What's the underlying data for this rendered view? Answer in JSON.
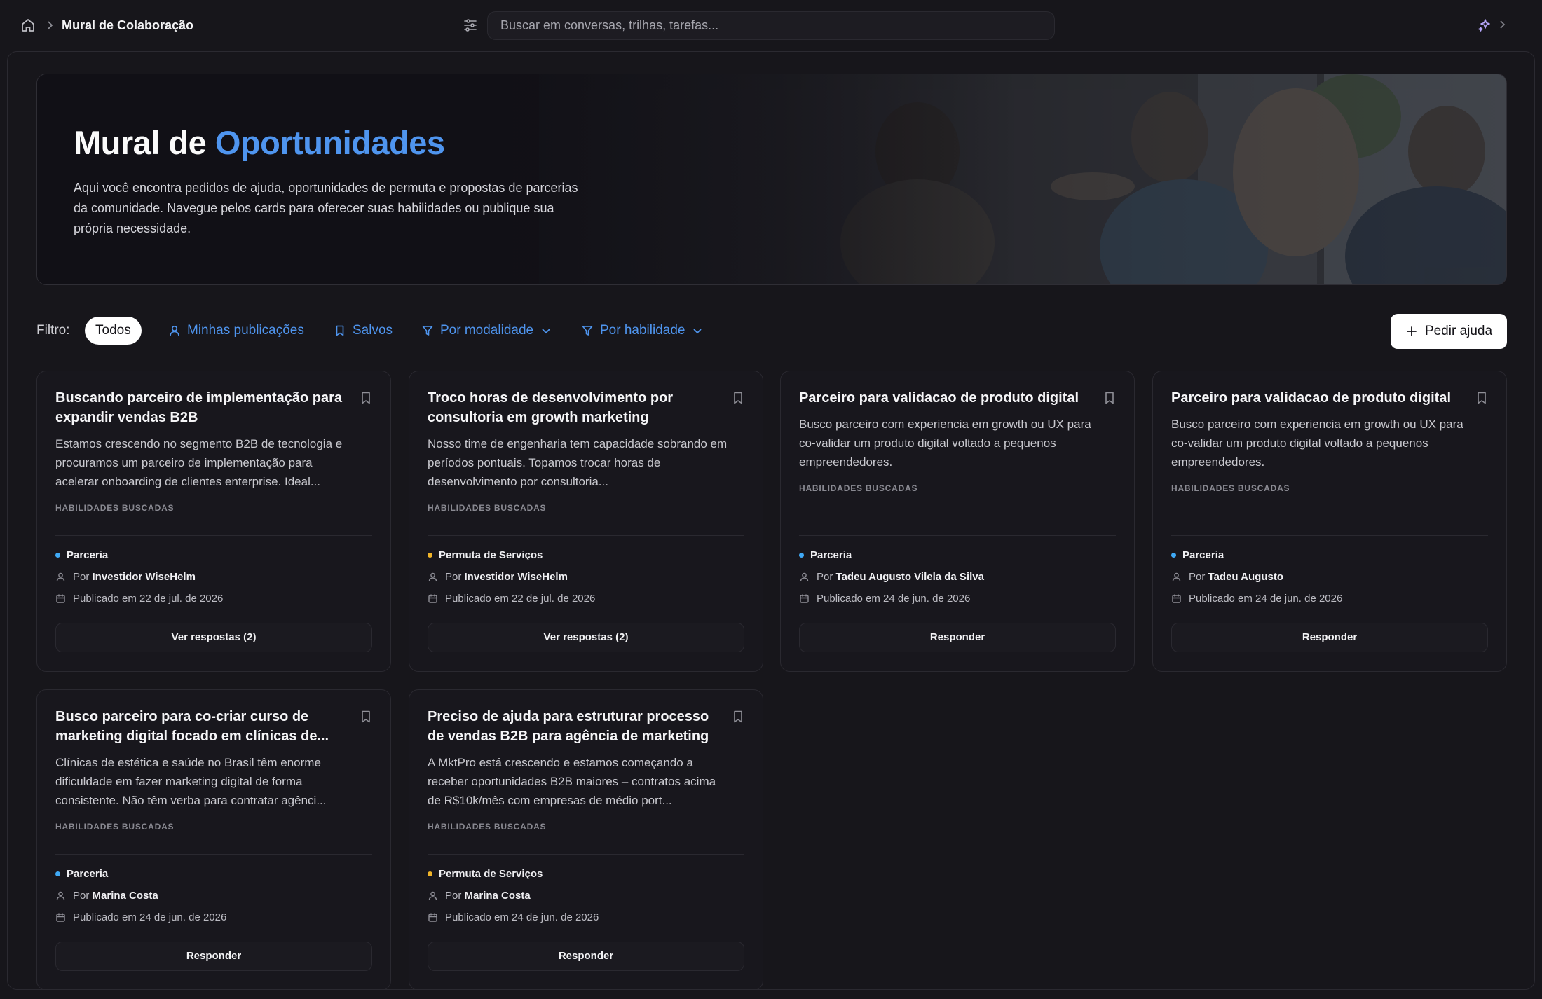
{
  "topbar": {
    "breadcrumb_title": "Mural de Colaboração",
    "search_placeholder": "Buscar em conversas, trilhas, tarefas...",
    "icons": [
      "home-icon",
      "chevron-right-icon",
      "filter-sliders-icon",
      "sparkle-icon",
      "chevron-right-icon"
    ]
  },
  "hero": {
    "title_prefix": "Mural de",
    "title_accent": "Oportunidades",
    "description": "Aqui você encontra pedidos de ajuda, oportunidades de permuta e propostas de parcerias da comunidade. Navegue pelos cards para oferecer suas habilidades ou publique sua própria necessidade.",
    "accent_color": "#4f95ef"
  },
  "filters": {
    "label": "Filtro:",
    "all": "Todos",
    "mine": "Minhas publicações",
    "saved": "Salvos",
    "by_mode": "Por modalidade",
    "by_skill": "Por habilidade",
    "new_request": "Pedir ajuda"
  },
  "cards": [
    {
      "title": "Buscando parceiro de implementação para expandir vendas B2B",
      "description": "Estamos crescendo no segmento B2B de tecnologia e procuramos um parceiro de implementação para acelerar onboarding de clientes enterprise. Ideal...",
      "skills_label": "HABILIDADES BUSCADAS",
      "type": "Parceria",
      "type_color": "#3fa9f5",
      "author_prefix": "Por",
      "author": "Investidor WiseHelm",
      "published": "Publicado em 22 de jul. de 2026",
      "action": "Ver respostas (2)"
    },
    {
      "title": "Troco horas de desenvolvimento por consultoria em growth marketing",
      "description": "Nosso time de engenharia tem capacidade sobrando em períodos pontuais. Topamos trocar horas de desenvolvimento por consultoria...",
      "skills_label": "HABILIDADES BUSCADAS",
      "type": "Permuta de Serviços",
      "type_color": "#f0b429",
      "author_prefix": "Por",
      "author": "Investidor WiseHelm",
      "published": "Publicado em 22 de jul. de 2026",
      "action": "Ver respostas (2)"
    },
    {
      "title": "Parceiro para validacao de produto digital",
      "description": "Busco parceiro com experiencia em growth ou UX para co-validar um produto digital voltado a pequenos empreendedores.",
      "skills_label": "HABILIDADES BUSCADAS",
      "type": "Parceria",
      "type_color": "#3fa9f5",
      "author_prefix": "Por",
      "author": "Tadeu Augusto Vilela da Silva",
      "published": "Publicado em 24 de jun. de 2026",
      "action": "Responder"
    },
    {
      "title": "Parceiro para validacao de produto digital",
      "description": "Busco parceiro com experiencia em growth ou UX para co-validar um produto digital voltado a pequenos empreendedores.",
      "skills_label": "HABILIDADES BUSCADAS",
      "type": "Parceria",
      "type_color": "#3fa9f5",
      "author_prefix": "Por",
      "author": "Tadeu Augusto",
      "published": "Publicado em 24 de jun. de 2026",
      "action": "Responder"
    },
    {
      "title": "Busco parceiro para co-criar curso de marketing digital focado em clínicas de...",
      "description": "Clínicas de estética e saúde no Brasil têm enorme dificuldade em fazer marketing digital de forma consistente. Não têm verba para contratar agênci...",
      "skills_label": "HABILIDADES BUSCADAS",
      "type": "Parceria",
      "type_color": "#3fa9f5",
      "author_prefix": "Por",
      "author": "Marina Costa",
      "published": "Publicado em 24 de jun. de 2026",
      "action": "Responder"
    },
    {
      "title": "Preciso de ajuda para estruturar processo de vendas B2B para agência de marketing",
      "description": "A MktPro está crescendo e estamos começando a receber oportunidades B2B maiores – contratos acima de R$10k/mês com empresas de médio port...",
      "skills_label": "HABILIDADES BUSCADAS",
      "type": "Permuta de Serviços",
      "type_color": "#f0b429",
      "author_prefix": "Por",
      "author": "Marina Costa",
      "published": "Publicado em 24 de jun. de 2026",
      "action": "Responder"
    }
  ]
}
